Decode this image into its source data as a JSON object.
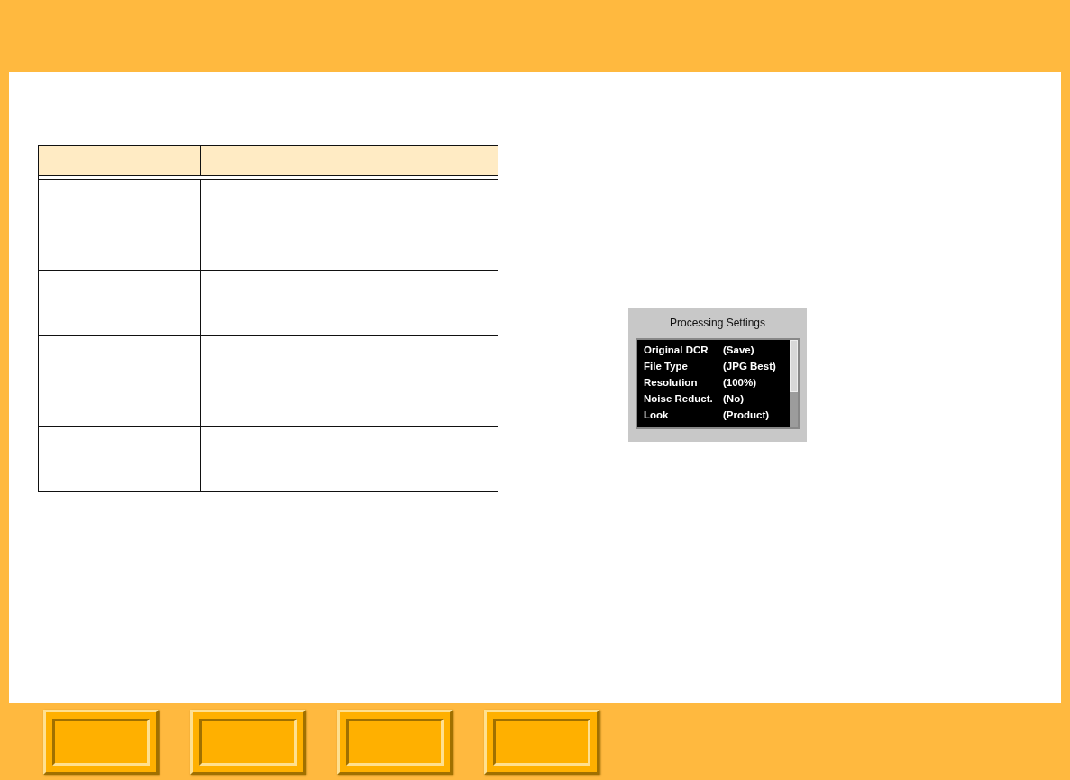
{
  "table": {
    "rows": [
      {
        "kind": "single"
      },
      {
        "kind": "single"
      },
      {
        "kind": "double"
      },
      {
        "kind": "single"
      },
      {
        "kind": "single"
      },
      {
        "kind": "double"
      }
    ]
  },
  "settings_panel": {
    "title": "Processing Settings",
    "items": [
      {
        "label": "Original DCR",
        "value": "(Save)"
      },
      {
        "label": "File Type",
        "value": "(JPG Best)"
      },
      {
        "label": "Resolution",
        "value": "(100%)"
      },
      {
        "label": "Noise Reduct.",
        "value": "(No)"
      },
      {
        "label": "Look",
        "value": "(Product)"
      }
    ]
  },
  "nav_buttons": [
    {
      "kind": "raised"
    },
    {
      "kind": "raised"
    },
    {
      "kind": "raised"
    },
    {
      "kind": "raised"
    }
  ]
}
